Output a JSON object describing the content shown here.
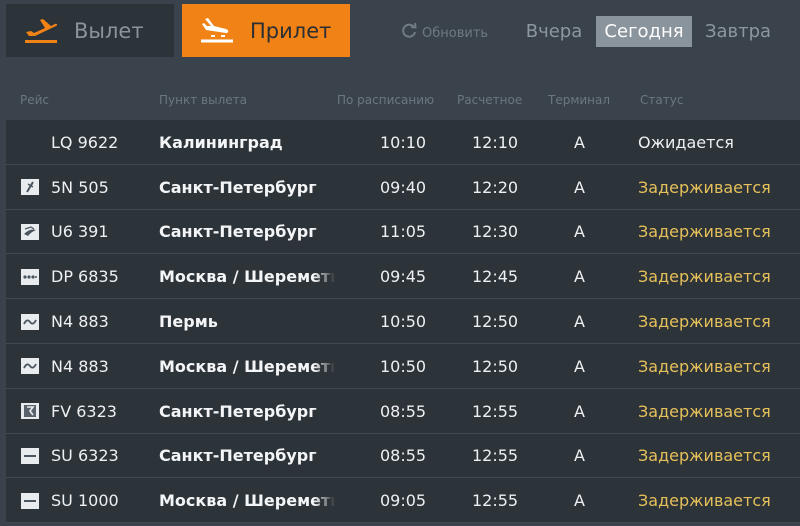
{
  "tabs": {
    "departure": {
      "label": "Вылет",
      "icon": "plane-takeoff-icon"
    },
    "arrival": {
      "label": "Прилет",
      "icon": "plane-landing-icon"
    }
  },
  "refresh": {
    "label": "Обновить",
    "icon": "refresh-icon"
  },
  "days": {
    "yesterday": "Вчера",
    "today": "Сегодня",
    "tomorrow": "Завтра"
  },
  "columns": {
    "flight": "Рейс",
    "origin": "Пункт вылета",
    "scheduled": "По расписанию",
    "estimated": "Расчетное",
    "terminal": "Терминал",
    "status": "Статус"
  },
  "colors": {
    "accent": "#f18216",
    "delayed": "#e6c05a",
    "background": "#3a424b",
    "row": "#2c3339"
  },
  "flights": [
    {
      "logo": "none",
      "flight": "LQ 9622",
      "origin": "Калининград",
      "scheduled": "10:10",
      "estimated": "12:10",
      "terminal": "A",
      "status": "Ожидается",
      "status_type": "expected"
    },
    {
      "logo": "airline-logo-5n",
      "flight": "5N 505",
      "origin": "Санкт-Петербург",
      "scheduled": "09:40",
      "estimated": "12:20",
      "terminal": "A",
      "status": "Задерживается",
      "status_type": "delayed"
    },
    {
      "logo": "airline-logo-u6",
      "flight": "U6 391",
      "origin": "Санкт-Петербург",
      "scheduled": "11:05",
      "estimated": "12:30",
      "terminal": "A",
      "status": "Задерживается",
      "status_type": "delayed"
    },
    {
      "logo": "airline-logo-dp",
      "flight": "DP 6835",
      "origin": "Москва / Шереметьево",
      "scheduled": "09:45",
      "estimated": "12:45",
      "terminal": "A",
      "status": "Задерживается",
      "status_type": "delayed"
    },
    {
      "logo": "airline-logo-n4",
      "flight": "N4 883",
      "origin": "Пермь",
      "scheduled": "10:50",
      "estimated": "12:50",
      "terminal": "A",
      "status": "Задерживается",
      "status_type": "delayed"
    },
    {
      "logo": "airline-logo-n4",
      "flight": "N4 883",
      "origin": "Москва / Шереметьево",
      "scheduled": "10:50",
      "estimated": "12:50",
      "terminal": "A",
      "status": "Задерживается",
      "status_type": "delayed"
    },
    {
      "logo": "airline-logo-fv",
      "flight": "FV 6323",
      "origin": "Санкт-Петербург",
      "scheduled": "08:55",
      "estimated": "12:55",
      "terminal": "A",
      "status": "Задерживается",
      "status_type": "delayed"
    },
    {
      "logo": "airline-logo-su",
      "flight": "SU 6323",
      "origin": "Санкт-Петербург",
      "scheduled": "08:55",
      "estimated": "12:55",
      "terminal": "A",
      "status": "Задерживается",
      "status_type": "delayed"
    },
    {
      "logo": "airline-logo-su",
      "flight": "SU 1000",
      "origin": "Москва / Шереметьево",
      "scheduled": "09:05",
      "estimated": "12:55",
      "terminal": "A",
      "status": "Задерживается",
      "status_type": "delayed"
    }
  ]
}
